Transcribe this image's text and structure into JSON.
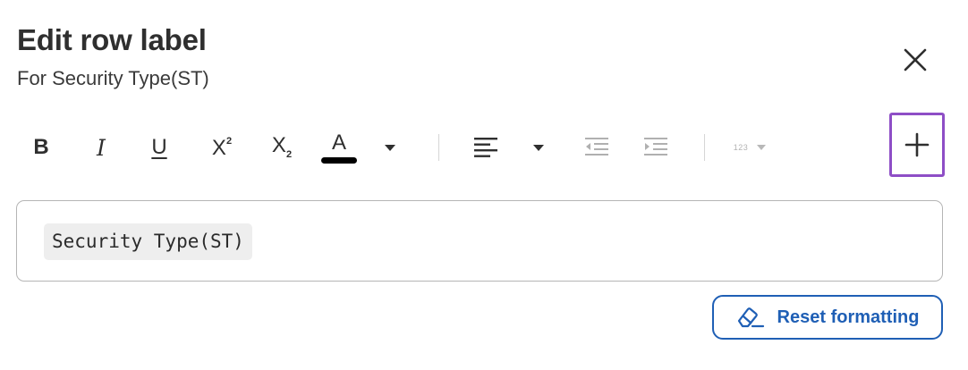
{
  "dialog": {
    "title": "Edit row label",
    "subtitle": "For Security Type(ST)",
    "close_icon": "close-icon"
  },
  "toolbar": {
    "bold": {
      "label": "B",
      "icon": "bold-icon"
    },
    "italic": {
      "label": "I",
      "icon": "italic-icon"
    },
    "underline": {
      "label": "U",
      "icon": "underline-icon"
    },
    "superscript": {
      "base": "X",
      "mark": "2",
      "icon": "superscript-icon"
    },
    "subscript": {
      "base": "X",
      "mark": "2",
      "icon": "subscript-icon"
    },
    "text_color": {
      "letter": "A",
      "color": "#000000",
      "icon": "text-color-icon"
    },
    "align_icon": "align-left-icon",
    "outdent_icon": "outdent-icon",
    "indent_icon": "indent-icon",
    "number_format": {
      "label": "123",
      "icon": "number-format-icon"
    },
    "add_icon": "plus-icon"
  },
  "editor": {
    "chip_text": "Security Type(ST)"
  },
  "reset": {
    "label": "Reset formatting",
    "icon": "eraser-icon"
  },
  "colors": {
    "accent_blue": "#1f5fb5",
    "focus_purple": "#8e4ec6",
    "disabled_grey": "#a9a9a9"
  }
}
